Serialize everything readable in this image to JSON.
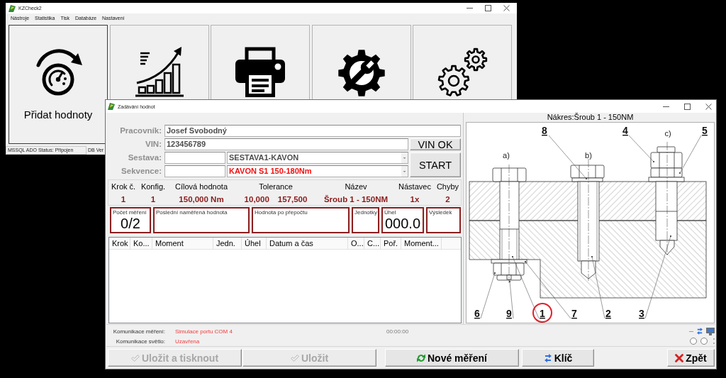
{
  "background_window": {
    "title": "KZCheck2",
    "menu": [
      "Nástroje",
      "Statistika",
      "Tisk",
      "Databáze",
      "Nastavení"
    ],
    "tiles": [
      {
        "kind": "gauge",
        "label": "Přidat hodnoty",
        "selected": true
      },
      {
        "kind": "chart",
        "selected": false
      },
      {
        "kind": "printer",
        "selected": false
      },
      {
        "kind": "tools",
        "selected": false
      },
      {
        "kind": "gears",
        "selected": false
      }
    ],
    "status_bar": [
      "MSSQL ADO Status: Připojen",
      "DB Ver"
    ]
  },
  "dialog": {
    "title": "Zadávání hodnot",
    "operator": {
      "label": "Pracovník:",
      "value": "Josef Svobodný"
    },
    "vin": {
      "label": "VIN:",
      "value": "123456789",
      "button": "VIN OK"
    },
    "assembly": {
      "label": "Sestava:",
      "value": "SESTAVA1-KAVON"
    },
    "sequence": {
      "label": "Sekvence:",
      "value": "KAVON S1 150-180Nm"
    },
    "start_button": "START",
    "step_info": [
      {
        "header": "Krok č.",
        "values": [
          "1"
        ]
      },
      {
        "header": "Konfig.",
        "values": [
          "1"
        ]
      },
      {
        "header": "Cílová hodnota",
        "values": [
          "150,000 Nm"
        ]
      },
      {
        "header": "Tolerance",
        "values": [
          "10,000",
          "157,500"
        ]
      },
      {
        "header": "Název",
        "values": [
          "Šroub 1 - 150NM"
        ]
      },
      {
        "header": "Nástavec",
        "values": [
          "1x"
        ]
      },
      {
        "header": "Chyby",
        "values": [
          "2"
        ]
      }
    ],
    "readouts": [
      {
        "label": "Počet měření",
        "value": "0/2"
      },
      {
        "label": "Poslední naměřená hodnota"
      },
      {
        "label": "Hodnota po přepočtu"
      },
      {
        "label": "Jednotky"
      },
      {
        "label": "Úhel",
        "value": "000.0"
      },
      {
        "label": "Výsledek"
      }
    ],
    "table": {
      "columns": [
        "Krok",
        "Ko...",
        "Moment",
        "Jedn.",
        "Úhel",
        "Datum a čas",
        "O...",
        "C...",
        "Poř.",
        "Moment..."
      ]
    },
    "drawing": {
      "title": "Nákres:Šroub 1 - 150NM",
      "variant_labels": [
        "a)",
        "b)",
        "c)"
      ],
      "callouts": [
        {
          "number": "8",
          "selected": false
        },
        {
          "number": "4",
          "selected": false
        },
        {
          "number": "5",
          "selected": false
        },
        {
          "number": "6",
          "selected": false
        },
        {
          "number": "9",
          "selected": false
        },
        {
          "number": "1",
          "selected": true
        },
        {
          "number": "7",
          "selected": false
        },
        {
          "number": "2",
          "selected": false
        },
        {
          "number": "3",
          "selected": false
        }
      ]
    },
    "status": [
      {
        "label": "Komunikace měření:",
        "value": "Simulace portu COM 4",
        "timer": "00:00:00"
      },
      {
        "label": "Komunikace světlo:",
        "value": "Uzavřena"
      }
    ],
    "buttons": [
      {
        "label": "Uložit a tisknout",
        "kind": "print",
        "disabled": true
      },
      {
        "label": "Uložit",
        "kind": "save",
        "disabled": true
      },
      {
        "label": "Nové měření",
        "kind": "new",
        "disabled": false
      },
      {
        "label": "Klíč",
        "kind": "key",
        "disabled": false
      },
      {
        "label": "Zpět",
        "kind": "back",
        "disabled": false
      }
    ]
  }
}
